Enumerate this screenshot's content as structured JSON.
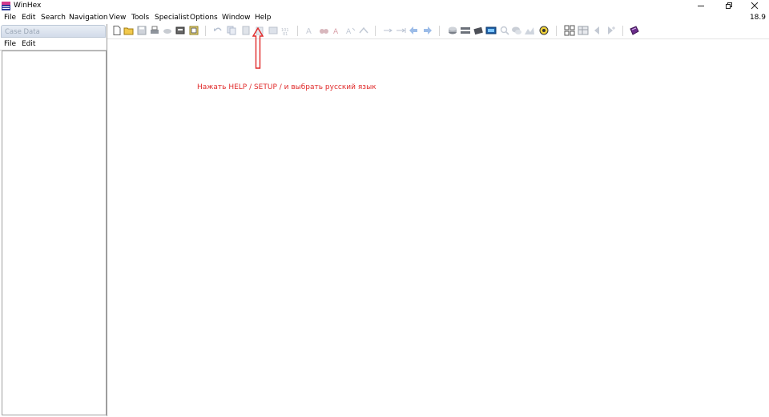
{
  "window": {
    "title": "WinHex",
    "icon": "winhex-app-icon",
    "controls": [
      "minimize-icon",
      "restore-icon",
      "close-icon"
    ]
  },
  "menubar": {
    "items": [
      "File",
      "Edit",
      "Search",
      "Navigation",
      "View",
      "Tools",
      "Specialist",
      "Options",
      "Window",
      "Help"
    ],
    "version": "18.9"
  },
  "case_panel": {
    "title": "Case Data",
    "menu": [
      "File",
      "Edit"
    ]
  },
  "toolbar": {
    "icons": [
      "new-file-icon",
      "open-folder-icon",
      "save-icon",
      "print-icon",
      "properties-icon",
      "open-disk-icon",
      "undo-icon",
      "copy-icon",
      "paste-icon",
      "clipboard-icon",
      "write-icon",
      "find-text-icon",
      "find-hex-icon",
      "replace-text-icon",
      "replace-hex-icon",
      "goto-offset-icon",
      "goto-sector-icon",
      "back-icon",
      "forward-icon",
      "disk-editor-icon",
      "disk-clone-icon",
      "ram-editor-icon",
      "screen-icon",
      "search-icon",
      "chat-icon",
      "chart-icon",
      "gallery-icon",
      "grid-icon",
      "table-icon",
      "previous-icon",
      "next-icon",
      "book-icon"
    ]
  },
  "annotation": {
    "text": "Нажать HELP / SETUP / и выбрать русский язык",
    "color": "#e02a2a"
  }
}
